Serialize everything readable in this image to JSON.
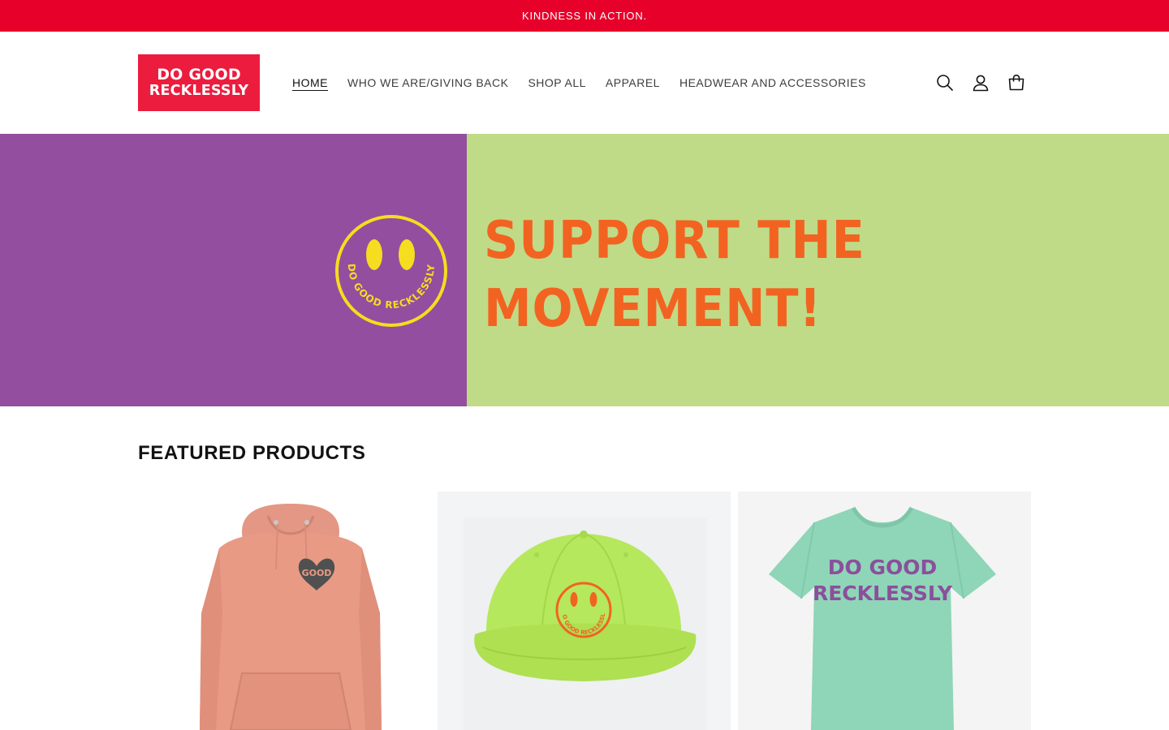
{
  "announcement": {
    "text": "KINDNESS IN ACTION."
  },
  "header": {
    "logo": {
      "line1": "DO GOOD",
      "line2": "RECKLESSLY",
      "color": "#ec1c3e"
    },
    "nav": [
      {
        "label": "HOME",
        "active": true
      },
      {
        "label": "WHO WE ARE/GIVING BACK",
        "active": false
      },
      {
        "label": "SHOP ALL",
        "active": false
      },
      {
        "label": "APPAREL",
        "active": false
      },
      {
        "label": "HEADWEAR AND ACCESSORIES",
        "active": false
      }
    ],
    "icons": [
      "search-icon",
      "account-icon",
      "cart-icon"
    ]
  },
  "hero": {
    "left_color": "#944e9f",
    "right_color": "#bfdb87",
    "headline_line1": "SUPPORT THE",
    "headline_line2": "MOVEMENT!",
    "headline_color": "#f26322",
    "smiley_text": "DO GOOD RECKLESSLY",
    "smiley_color": "#f5dd1f"
  },
  "featured": {
    "title": "FEATURED PRODUCTS",
    "products": [
      {
        "image": "pink-hoodie",
        "print_text": "GOOD",
        "color": "#e99a85"
      },
      {
        "image": "lime-cap",
        "print_text": "DO GOOD RECKLESSLY",
        "color": "#b3e85a"
      },
      {
        "image": "mint-tshirt",
        "print_line1": "DO GOOD",
        "print_line2": "RECKLESSLY",
        "color": "#8fd5b8"
      }
    ]
  }
}
